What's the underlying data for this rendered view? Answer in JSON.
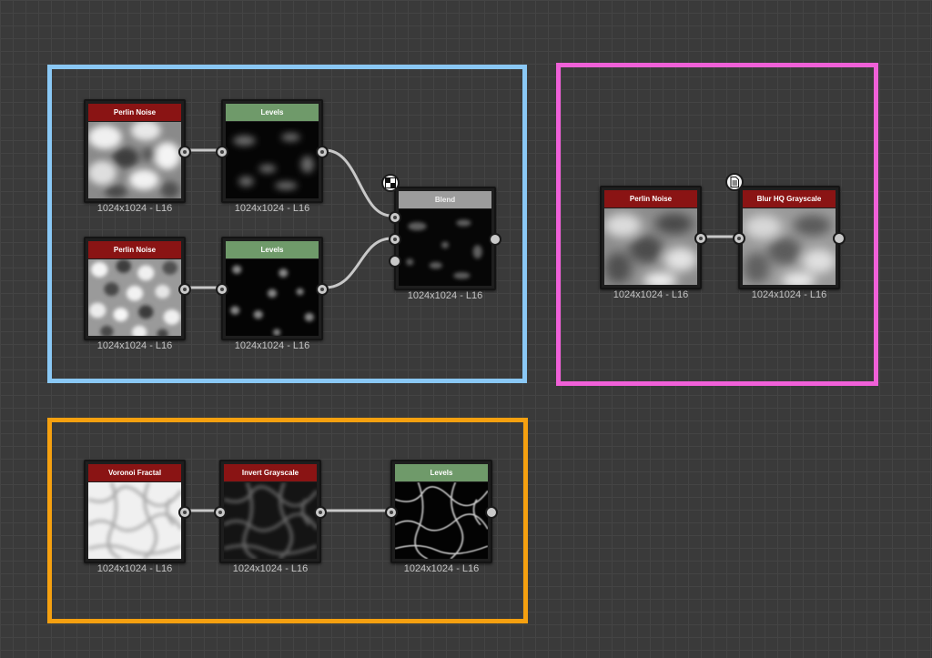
{
  "frames": [
    {
      "name": "blue-frame",
      "color": "#8ac8f5"
    },
    {
      "name": "pink-frame",
      "color": "#f060d8"
    },
    {
      "name": "orange-frame",
      "color": "#f5a010"
    }
  ],
  "colors": {
    "header_generator": "#8a1414",
    "header_adjust": "#6f9a6a",
    "header_blend": "#9c9c9c",
    "wire": "#c8c8c8",
    "canvas": "#3a3a3a"
  },
  "nodes": {
    "perlin1": {
      "title": "Perlin Noise",
      "resolution": "1024x1024 - L16"
    },
    "levels1": {
      "title": "Levels",
      "resolution": "1024x1024 - L16"
    },
    "perlin2": {
      "title": "Perlin Noise",
      "resolution": "1024x1024 - L16"
    },
    "levels2": {
      "title": "Levels",
      "resolution": "1024x1024 - L16"
    },
    "blend": {
      "title": "Blend",
      "resolution": "1024x1024 - L16",
      "badge_icon": "blend-mode-icon"
    },
    "perlin3": {
      "title": "Perlin Noise",
      "resolution": "1024x1024 - L16"
    },
    "blur": {
      "title": "Blur HQ Grayscale",
      "resolution": "1024x1024 - L16",
      "badge_icon": "document-icon"
    },
    "voronoi": {
      "title": "Voronoi Fractal",
      "resolution": "1024x1024 - L16"
    },
    "invert": {
      "title": "Invert Grayscale",
      "resolution": "1024x1024 - L16"
    },
    "levels3": {
      "title": "Levels",
      "resolution": "1024x1024 - L16"
    }
  }
}
